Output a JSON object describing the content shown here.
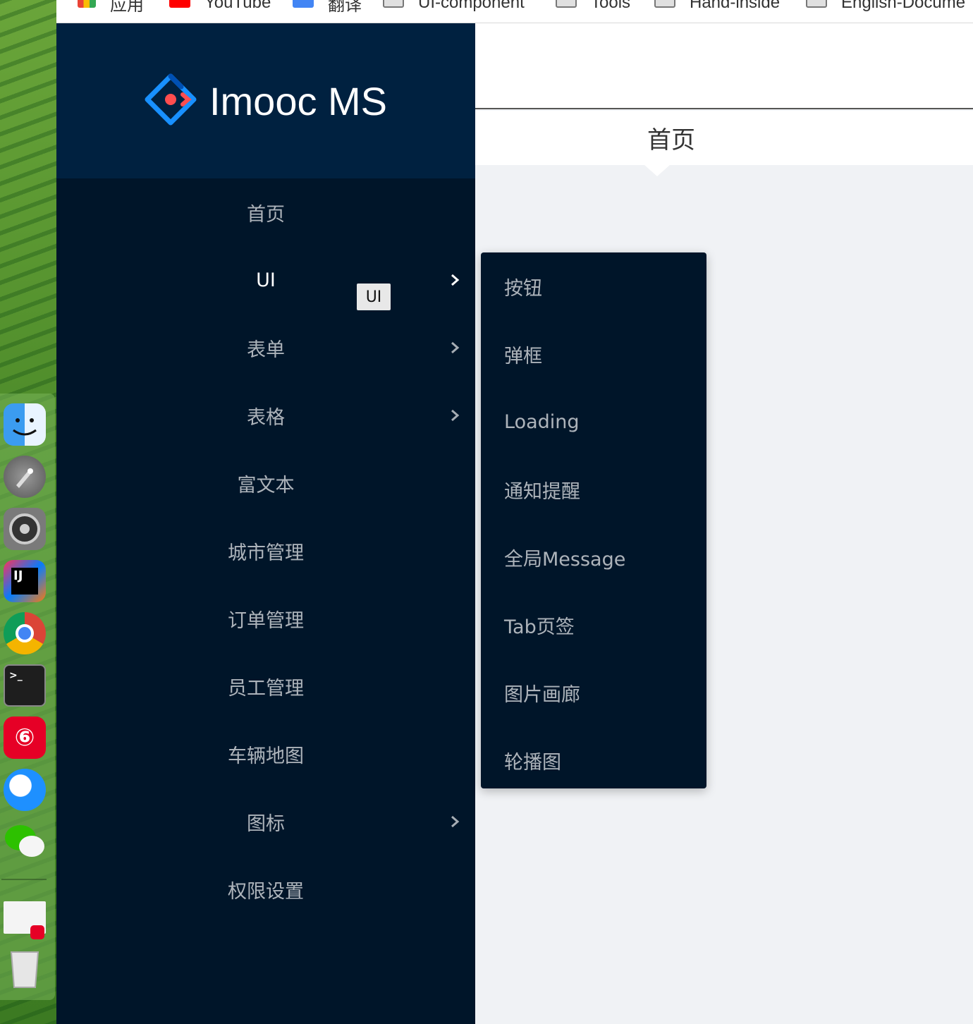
{
  "browser": {
    "bookmarks": [
      {
        "label": "应用",
        "icon": "apps-grid-icon",
        "color": "#34a853"
      },
      {
        "label": "YouTube",
        "icon": "youtube-icon",
        "color": "#ff0000"
      },
      {
        "label": "翻译",
        "icon": "translate-icon",
        "color": "#4285f4"
      },
      {
        "label": "UI-component",
        "icon": "folder-icon",
        "color": "#9e9e9e"
      },
      {
        "label": "Tools",
        "icon": "folder-icon",
        "color": "#9e9e9e"
      },
      {
        "label": "Hand-inside",
        "icon": "folder-icon",
        "color": "#9e9e9e"
      },
      {
        "label": "English-Docume",
        "icon": "folder-icon",
        "color": "#9e9e9e"
      }
    ]
  },
  "app": {
    "brand": "Imooc MS",
    "accent_color": "#1890ff",
    "sidebar_bg": "#001529"
  },
  "menu": {
    "items": [
      {
        "label": "首页",
        "has_children": false,
        "active": false
      },
      {
        "label": "UI",
        "has_children": true,
        "active": true
      },
      {
        "label": "表单",
        "has_children": true,
        "active": false
      },
      {
        "label": "表格",
        "has_children": true,
        "active": false
      },
      {
        "label": "富文本",
        "has_children": false,
        "active": false
      },
      {
        "label": "城市管理",
        "has_children": false,
        "active": false
      },
      {
        "label": "订单管理",
        "has_children": false,
        "active": false
      },
      {
        "label": "员工管理",
        "has_children": false,
        "active": false
      },
      {
        "label": "车辆地图",
        "has_children": false,
        "active": false
      },
      {
        "label": "图标",
        "has_children": true,
        "active": false
      },
      {
        "label": "权限设置",
        "has_children": false,
        "active": false
      }
    ],
    "tooltip": "UI"
  },
  "submenu": {
    "items": [
      "按钮",
      "弹框",
      "Loading",
      "通知提醒",
      "全局Message",
      "Tab页签",
      "图片画廊",
      "轮播图"
    ]
  },
  "main": {
    "breadcrumb": "首页"
  },
  "dock": {
    "icons": [
      "finder-icon",
      "launchpad-icon",
      "system-preferences-icon",
      "intellij-icon",
      "chrome-icon",
      "terminal-icon",
      "netease-music-icon",
      "cloud-drive-icon",
      "wechat-icon",
      "preview-thumbnail-icon",
      "trash-icon"
    ]
  }
}
